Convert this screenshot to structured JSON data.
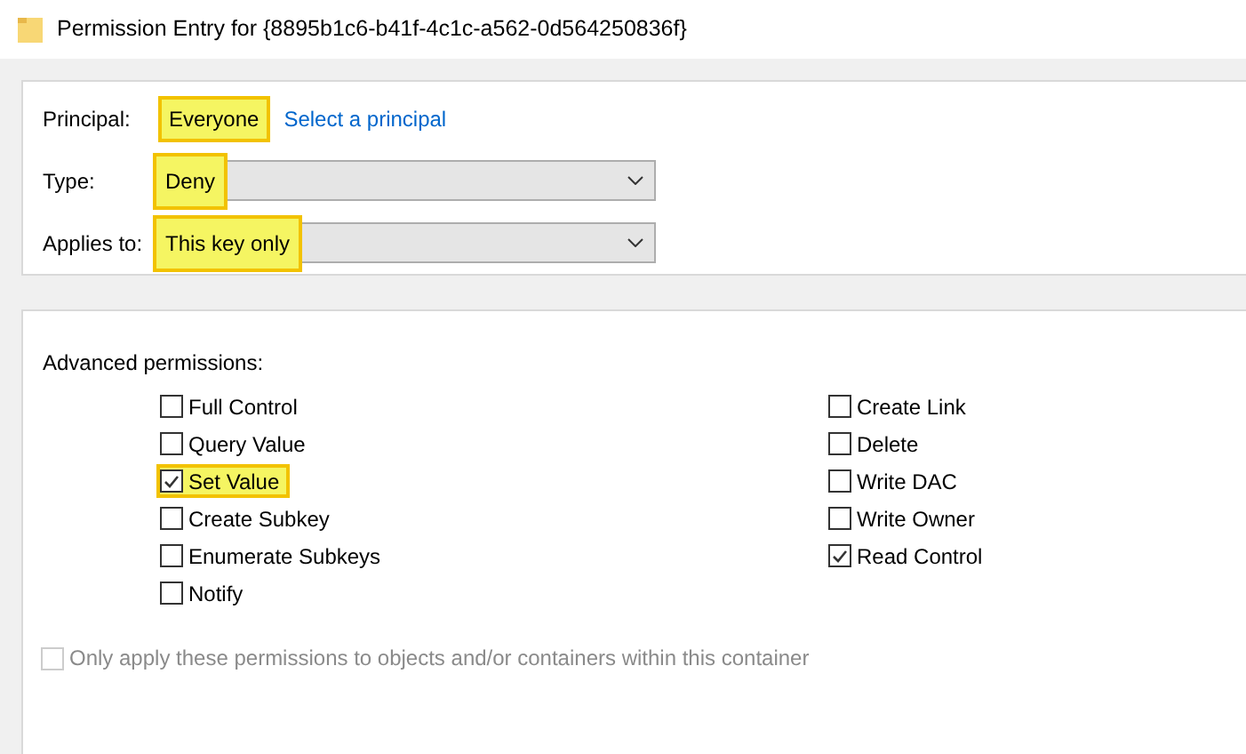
{
  "window": {
    "title": "Permission Entry for {8895b1c6-b41f-4c1c-a562-0d564250836f}"
  },
  "principal": {
    "label": "Principal:",
    "value": "Everyone",
    "highlighted": true,
    "link": "Select a principal"
  },
  "fields": [
    {
      "label": "Type:",
      "value": "Deny",
      "highlighted": true
    },
    {
      "label": "Applies to:",
      "value": "This key only",
      "highlighted": true
    }
  ],
  "advanced": {
    "heading": "Advanced permissions:",
    "columns": [
      [
        {
          "label": "Full Control",
          "checked": false,
          "highlighted": false
        },
        {
          "label": "Query Value",
          "checked": false,
          "highlighted": false
        },
        {
          "label": "Set Value",
          "checked": true,
          "highlighted": true
        },
        {
          "label": "Create Subkey",
          "checked": false,
          "highlighted": false
        },
        {
          "label": "Enumerate Subkeys",
          "checked": false,
          "highlighted": false
        },
        {
          "label": "Notify",
          "checked": false,
          "highlighted": false
        }
      ],
      [
        {
          "label": "Create Link",
          "checked": false,
          "highlighted": false
        },
        {
          "label": "Delete",
          "checked": false,
          "highlighted": false
        },
        {
          "label": "Write DAC",
          "checked": false,
          "highlighted": false
        },
        {
          "label": "Write Owner",
          "checked": false,
          "highlighted": false
        },
        {
          "label": "Read Control",
          "checked": true,
          "highlighted": false
        }
      ]
    ]
  },
  "only_apply": {
    "label": "Only apply these permissions to objects and/or containers within this container",
    "checked": false,
    "disabled": true
  }
}
